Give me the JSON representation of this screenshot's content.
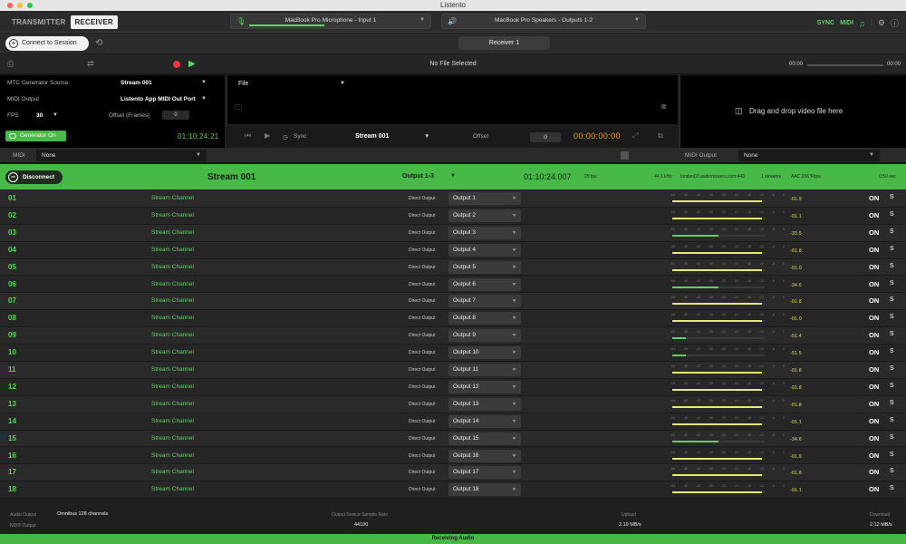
{
  "window": {
    "title": "Listento"
  },
  "tabs": [
    "TRANSMITTER",
    "RECEIVER"
  ],
  "input_device": {
    "label": "MacBook Pro Microphone - Input 1",
    "level": 0.55
  },
  "output_device": {
    "label": "MacBook Pro Speakers - Outputs 1-2",
    "level": 0.0
  },
  "top_right": {
    "sync": "SYNC",
    "midi": "MIDI"
  },
  "session": {
    "connect_label": "Connect to Session",
    "receiver_label": "Receiver 1"
  },
  "transport": {
    "file_status": "No File Selected",
    "time_start": "00:00",
    "time_end": "00:00"
  },
  "mtc": {
    "source_label": "MTC Generator Source",
    "source_value": "Stream 001",
    "midi_output_label": "MIDI Output",
    "midi_output_value": "Listento App MIDI Out Port",
    "fps_label": "FPS",
    "fps_value": "30",
    "offset_label": "Offset (Frames)",
    "offset_value": "0",
    "generator_label": "Generator On",
    "generator_time": "01:10:24:21"
  },
  "file_panel": {
    "file_label": "File"
  },
  "sync_bar": {
    "sync_label": "Sync",
    "stream": "Stream 001",
    "offset_label": "Offset",
    "offset_value": "0",
    "timecode": "00:00:00:00"
  },
  "video": {
    "drop_text": "Drag and drop video file here"
  },
  "midi_bar": {
    "midi_label": "MIDI",
    "midi_value": "None",
    "midi_output_label": "MIDI Output",
    "midi_output_value": "None"
  },
  "stream": {
    "disconnect_label": "Disconnect",
    "name": "Stream 001",
    "output": "Output 1-3",
    "time": "01:10:24.007",
    "fps": "25 fps",
    "sample_rate": "44.1 kHz",
    "server": "london03.audiomovers.com:443",
    "streams": "1 streams",
    "codec": "AAC 256 Kbps",
    "latency": "0.50 sec"
  },
  "meter_ticks": [
    "-54",
    "-48",
    "-42",
    "-36",
    "-30",
    "-24",
    "-18",
    "-12",
    "-6",
    "0"
  ],
  "channels": [
    {
      "num": "01",
      "name": "Stream Channel",
      "type": "Direct Output",
      "output": "Output 1",
      "level": 0.97,
      "db": "-01.9",
      "on": "ON",
      "solo": "S"
    },
    {
      "num": "02",
      "name": "Stream Channel",
      "type": "Direct Output",
      "output": "Output 2",
      "level": 0.97,
      "db": "-01.1",
      "on": "ON",
      "solo": "S"
    },
    {
      "num": "03",
      "name": "Stream Channel",
      "type": "Direct Output",
      "output": "Output 3",
      "level": 0.5,
      "db": "-33.5",
      "on": "ON",
      "solo": "S"
    },
    {
      "num": "04",
      "name": "Stream Channel",
      "type": "Direct Output",
      "output": "Output 4",
      "level": 0.97,
      "db": "-01.8",
      "on": "ON",
      "solo": "S"
    },
    {
      "num": "05",
      "name": "Stream Channel",
      "type": "Direct Output",
      "output": "Output 5",
      "level": 0.97,
      "db": "-01.0",
      "on": "ON",
      "solo": "S"
    },
    {
      "num": "06",
      "name": "Stream Channel",
      "type": "Direct Output",
      "output": "Output 6",
      "level": 0.5,
      "db": "-34.6",
      "on": "ON",
      "solo": "S"
    },
    {
      "num": "07",
      "name": "Stream Channel",
      "type": "Direct Output",
      "output": "Output 7",
      "level": 0.97,
      "db": "-01.8",
      "on": "ON",
      "solo": "S"
    },
    {
      "num": "08",
      "name": "Stream Channel",
      "type": "Direct Output",
      "output": "Output 8",
      "level": 0.97,
      "db": "-01.0",
      "on": "ON",
      "solo": "S"
    },
    {
      "num": "09",
      "name": "Stream Channel",
      "type": "Direct Output",
      "output": "Output 9",
      "level": 0.15,
      "db": "-51.4",
      "on": "ON",
      "solo": "S"
    },
    {
      "num": "10",
      "name": "Stream Channel",
      "type": "Direct Output",
      "output": "Output 10",
      "level": 0.15,
      "db": "-51.5",
      "on": "ON",
      "solo": "S"
    },
    {
      "num": "11",
      "name": "Stream Channel",
      "type": "Direct Output",
      "output": "Output 11",
      "level": 0.97,
      "db": "-01.8",
      "on": "ON",
      "solo": "S"
    },
    {
      "num": "12",
      "name": "Stream Channel",
      "type": "Direct Output",
      "output": "Output 12",
      "level": 0.97,
      "db": "-01.8",
      "on": "ON",
      "solo": "S"
    },
    {
      "num": "13",
      "name": "Stream Channel",
      "type": "Direct Output",
      "output": "Output 13",
      "level": 0.97,
      "db": "-01.8",
      "on": "ON",
      "solo": "S"
    },
    {
      "num": "14",
      "name": "Stream Channel",
      "type": "Direct Output",
      "output": "Output 14",
      "level": 0.97,
      "db": "-01.1",
      "on": "ON",
      "solo": "S"
    },
    {
      "num": "15",
      "name": "Stream Channel",
      "type": "Direct Output",
      "output": "Output 15",
      "level": 0.5,
      "db": "-34.6",
      "on": "ON",
      "solo": "S"
    },
    {
      "num": "16",
      "name": "Stream Channel",
      "type": "Direct Output",
      "output": "Output 16",
      "level": 0.97,
      "db": "-01.9",
      "on": "ON",
      "solo": "S"
    },
    {
      "num": "17",
      "name": "Stream Channel",
      "type": "Direct Output",
      "output": "Output 17",
      "level": 0.97,
      "db": "-01.8",
      "on": "ON",
      "solo": "S"
    },
    {
      "num": "18",
      "name": "Stream Channel",
      "type": "Direct Output",
      "output": "Output 18",
      "level": 0.97,
      "db": "-01.1",
      "on": "ON",
      "solo": "S"
    }
  ],
  "footer": {
    "audio_output_label": "Audio Output",
    "audio_output_value": "Omnibus 128 channels",
    "ndi_output_label": "NDI® Output",
    "sample_rate_label": "Output Device Sample Rate",
    "sample_rate_value": "44100",
    "upload_label": "Upload",
    "upload_value": "2.19 MB/s",
    "download_label": "Download",
    "download_value": "2.12 MB/s"
  },
  "status": "Receiving Audio",
  "colors": {
    "accent_green": "#47b947",
    "level_yellow": "#e8e870",
    "record_red": "#e23b3b",
    "timecode_orange": "#f0a020"
  }
}
